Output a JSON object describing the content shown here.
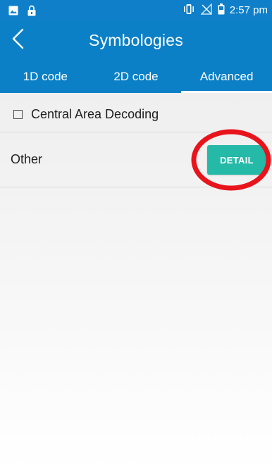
{
  "colors": {
    "primary": "#0b80c6",
    "accent": "#25b9a8",
    "highlight": "#e8141c"
  },
  "status_bar": {
    "time": "2:57 pm",
    "icons": [
      "image-icon",
      "lock-icon",
      "vibrate-icon",
      "no-signal-icon",
      "battery-icon"
    ]
  },
  "app_bar": {
    "title": "Symbologies",
    "back_icon": "chevron-left-icon"
  },
  "tabs": [
    {
      "label": "1D code",
      "active": false
    },
    {
      "label": "2D code",
      "active": false
    },
    {
      "label": "Advanced",
      "active": true
    }
  ],
  "settings": {
    "central_area_decoding": {
      "label": "Central Area Decoding",
      "checked": false
    },
    "other": {
      "label": "Other",
      "button_label": "DETAIL"
    }
  }
}
